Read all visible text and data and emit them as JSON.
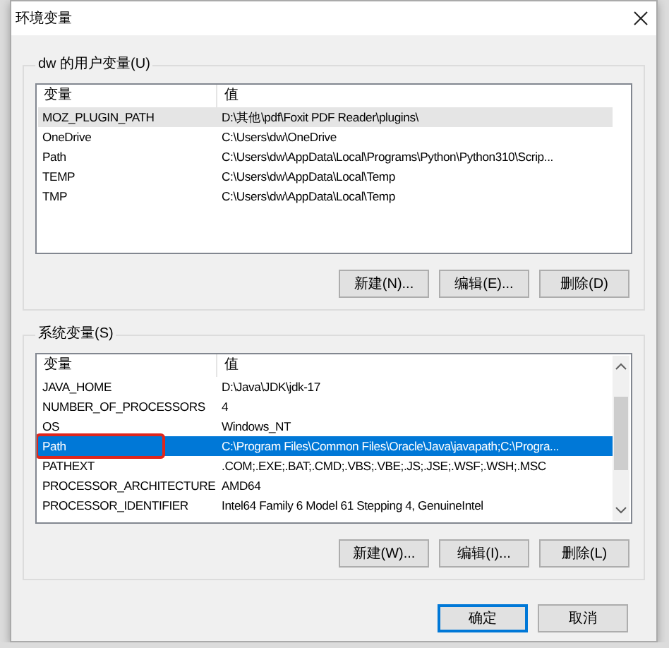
{
  "window": {
    "title": "环境变量"
  },
  "user_variables": {
    "label": "dw 的用户变量(U)",
    "focused": false,
    "columns": [
      "变量",
      "值"
    ],
    "rows": [
      {
        "name": "MOZ_PLUGIN_PATH",
        "value": "D:\\其他\\pdf\\Foxit PDF Reader\\plugins\\",
        "selected": true,
        "highlighted": false
      },
      {
        "name": "OneDrive",
        "value": "C:\\Users\\dw\\OneDrive",
        "selected": false,
        "highlighted": false
      },
      {
        "name": "Path",
        "value": "C:\\Users\\dw\\AppData\\Local\\Programs\\Python\\Python310\\Scrip...",
        "selected": false,
        "highlighted": false
      },
      {
        "name": "TEMP",
        "value": "C:\\Users\\dw\\AppData\\Local\\Temp",
        "selected": false,
        "highlighted": false
      },
      {
        "name": "TMP",
        "value": "C:\\Users\\dw\\AppData\\Local\\Temp",
        "selected": false,
        "highlighted": false
      }
    ],
    "scrollbar": false,
    "buttons": [
      "新建(N)...",
      "编辑(E)...",
      "删除(D)"
    ]
  },
  "system_variables": {
    "label": "系统变量(S)",
    "focused": true,
    "columns": [
      "变量",
      "值"
    ],
    "rows": [
      {
        "name": "JAVA_HOME",
        "value": "D:\\Java\\JDK\\jdk-17",
        "selected": false,
        "highlighted": false
      },
      {
        "name": "NUMBER_OF_PROCESSORS",
        "value": "4",
        "selected": false,
        "highlighted": false
      },
      {
        "name": "OS",
        "value": "Windows_NT",
        "selected": false,
        "highlighted": false
      },
      {
        "name": "Path",
        "value": "C:\\Program Files\\Common Files\\Oracle\\Java\\javapath;C:\\Progra...",
        "selected": true,
        "highlighted": true
      },
      {
        "name": "PATHEXT",
        "value": ".COM;.EXE;.BAT;.CMD;.VBS;.VBE;.JS;.JSE;.WSF;.WSH;.MSC",
        "selected": false,
        "highlighted": false
      },
      {
        "name": "PROCESSOR_ARCHITECTURE",
        "value": "AMD64",
        "selected": false,
        "highlighted": false
      },
      {
        "name": "PROCESSOR_IDENTIFIER",
        "value": "Intel64 Family 6 Model 61 Stepping 4, GenuineIntel",
        "selected": false,
        "highlighted": false
      }
    ],
    "scrollbar": true,
    "buttons": [
      "新建(W)...",
      "编辑(I)...",
      "删除(L)"
    ]
  },
  "buttons": [
    {
      "label": "确定",
      "default": true
    },
    {
      "label": "取消",
      "default": false
    }
  ]
}
